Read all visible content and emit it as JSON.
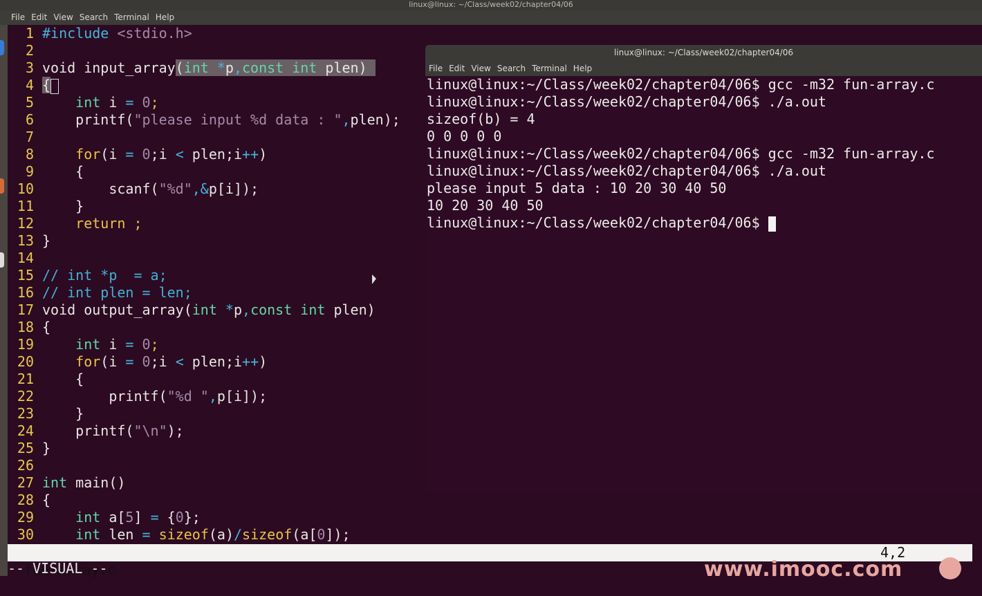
{
  "window_title": "linux@linux: ~/Class/week02/chapter04/06",
  "menu": [
    "File",
    "Edit",
    "View",
    "Search",
    "Terminal",
    "Help"
  ],
  "editor": {
    "filename": "fun-array.c",
    "cursor_position": "4,2",
    "mode": "-- VISUAL --",
    "lines": [
      {
        "n": "1",
        "t": [
          [
            "pre",
            "#include"
          ],
          [
            "lit",
            " <stdio.h>"
          ]
        ]
      },
      {
        "n": "2",
        "t": []
      },
      {
        "n": "3",
        "t": [
          [
            "",
            "void input_array"
          ],
          [
            "sel",
            "("
          ],
          [
            "tp sel",
            "int"
          ],
          [
            "sel",
            " "
          ],
          [
            "op sel",
            "*"
          ],
          [
            "sel",
            "p"
          ],
          [
            "op sel",
            ","
          ],
          [
            "tp sel",
            "const int"
          ],
          [
            "sel",
            " plen) "
          ]
        ]
      },
      {
        "n": "4",
        "t": [
          [
            "sel",
            "{"
          ]
        ],
        "cursor": true
      },
      {
        "n": "5",
        "t": [
          [
            "",
            "    "
          ],
          [
            "tp",
            "int"
          ],
          [
            "",
            " i "
          ],
          [
            "op",
            "="
          ],
          [
            "",
            " "
          ],
          [
            "lit",
            "0"
          ],
          [
            "kw",
            ";"
          ]
        ]
      },
      {
        "n": "6",
        "t": [
          [
            "",
            "    printf("
          ],
          [
            "lit",
            "\"please input %d data : \""
          ],
          [
            "op",
            ","
          ],
          [
            "",
            "plen);"
          ]
        ]
      },
      {
        "n": "7",
        "t": []
      },
      {
        "n": "8",
        "t": [
          [
            "",
            "    "
          ],
          [
            "kw",
            "for"
          ],
          [
            "",
            "(i "
          ],
          [
            "op",
            "="
          ],
          [
            "",
            " "
          ],
          [
            "lit",
            "0"
          ],
          [
            "",
            ";i "
          ],
          [
            "op",
            "<"
          ],
          [
            "",
            " plen;i"
          ],
          [
            "op",
            "++"
          ],
          [
            "",
            ")"
          ]
        ]
      },
      {
        "n": "9",
        "t": [
          [
            "",
            "    {"
          ]
        ]
      },
      {
        "n": "10",
        "t": [
          [
            "",
            "        scanf("
          ],
          [
            "lit",
            "\"%d\""
          ],
          [
            "op",
            ",&"
          ],
          [
            "",
            "p[i]);"
          ]
        ]
      },
      {
        "n": "11",
        "t": [
          [
            "",
            "    }"
          ]
        ]
      },
      {
        "n": "12",
        "t": [
          [
            "",
            "    "
          ],
          [
            "kw",
            "return ;"
          ]
        ]
      },
      {
        "n": "13",
        "t": [
          [
            "",
            "}"
          ]
        ]
      },
      {
        "n": "14",
        "t": []
      },
      {
        "n": "15",
        "t": [
          [
            "cm",
            "// int *p  = a;"
          ]
        ]
      },
      {
        "n": "16",
        "t": [
          [
            "cm",
            "// int plen = len;"
          ]
        ]
      },
      {
        "n": "17",
        "t": [
          [
            "",
            "void output_array("
          ],
          [
            "tp",
            "int"
          ],
          [
            "",
            " "
          ],
          [
            "op",
            "*"
          ],
          [
            "",
            "p"
          ],
          [
            "op",
            ","
          ],
          [
            "tp",
            "const int"
          ],
          [
            "",
            " plen)"
          ]
        ]
      },
      {
        "n": "18",
        "t": [
          [
            "",
            "{"
          ]
        ]
      },
      {
        "n": "19",
        "t": [
          [
            "",
            "    "
          ],
          [
            "tp",
            "int"
          ],
          [
            "",
            " i "
          ],
          [
            "op",
            "="
          ],
          [
            "",
            " "
          ],
          [
            "lit",
            "0"
          ],
          [
            "kw",
            ";"
          ]
        ]
      },
      {
        "n": "20",
        "t": [
          [
            "",
            "    "
          ],
          [
            "kw",
            "for"
          ],
          [
            "",
            "(i "
          ],
          [
            "op",
            "="
          ],
          [
            "",
            " "
          ],
          [
            "lit",
            "0"
          ],
          [
            "",
            ";i "
          ],
          [
            "op",
            "<"
          ],
          [
            "",
            " plen;i"
          ],
          [
            "op",
            "++"
          ],
          [
            "",
            ")"
          ]
        ]
      },
      {
        "n": "21",
        "t": [
          [
            "",
            "    {"
          ]
        ]
      },
      {
        "n": "22",
        "t": [
          [
            "",
            "        printf("
          ],
          [
            "lit",
            "\"%d \""
          ],
          [
            "op",
            ","
          ],
          [
            "",
            "p[i]);"
          ]
        ]
      },
      {
        "n": "23",
        "t": [
          [
            "",
            "    }"
          ]
        ]
      },
      {
        "n": "24",
        "t": [
          [
            "",
            "    printf("
          ],
          [
            "lit",
            "\"\\n\""
          ],
          [
            "",
            ");"
          ]
        ]
      },
      {
        "n": "25",
        "t": [
          [
            "",
            "}"
          ]
        ]
      },
      {
        "n": "26",
        "t": []
      },
      {
        "n": "27",
        "t": [
          [
            "tp",
            "int"
          ],
          [
            "",
            " main()"
          ]
        ]
      },
      {
        "n": "28",
        "t": [
          [
            "",
            "{"
          ]
        ]
      },
      {
        "n": "29",
        "t": [
          [
            "",
            "    "
          ],
          [
            "tp",
            "int"
          ],
          [
            "",
            " a["
          ],
          [
            "lit",
            "5"
          ],
          [
            "",
            "] "
          ],
          [
            "op",
            "="
          ],
          [
            "",
            " {"
          ],
          [
            "lit",
            "0"
          ],
          [
            "",
            "};"
          ]
        ]
      },
      {
        "n": "30",
        "t": [
          [
            "",
            "    "
          ],
          [
            "tp",
            "int"
          ],
          [
            "",
            " len "
          ],
          [
            "op",
            "="
          ],
          [
            "",
            " "
          ],
          [
            "kw",
            "sizeof"
          ],
          [
            "",
            "(a)"
          ],
          [
            "op",
            "/"
          ],
          [
            "kw",
            "sizeof"
          ],
          [
            "",
            "(a["
          ],
          [
            "lit",
            "0"
          ],
          [
            "",
            "]);"
          ]
        ]
      }
    ]
  },
  "terminal": {
    "title": "linux@linux: ~/Class/week02/chapter04/06",
    "lines": [
      "linux@linux:~/Class/week02/chapter04/06$ gcc -m32 fun-array.c",
      "linux@linux:~/Class/week02/chapter04/06$ ./a.out",
      "sizeof(b) = 4",
      "0 0 0 0 0",
      "linux@linux:~/Class/week02/chapter04/06$ gcc -m32 fun-array.c",
      "linux@linux:~/Class/week02/chapter04/06$ ./a.out",
      "please input 5 data : 10 20 30 40 50",
      "10 20 30 40 50"
    ],
    "prompt": "linux@linux:~/Class/week02/chapter04/06$ "
  },
  "watermark": "www.imooc.com"
}
